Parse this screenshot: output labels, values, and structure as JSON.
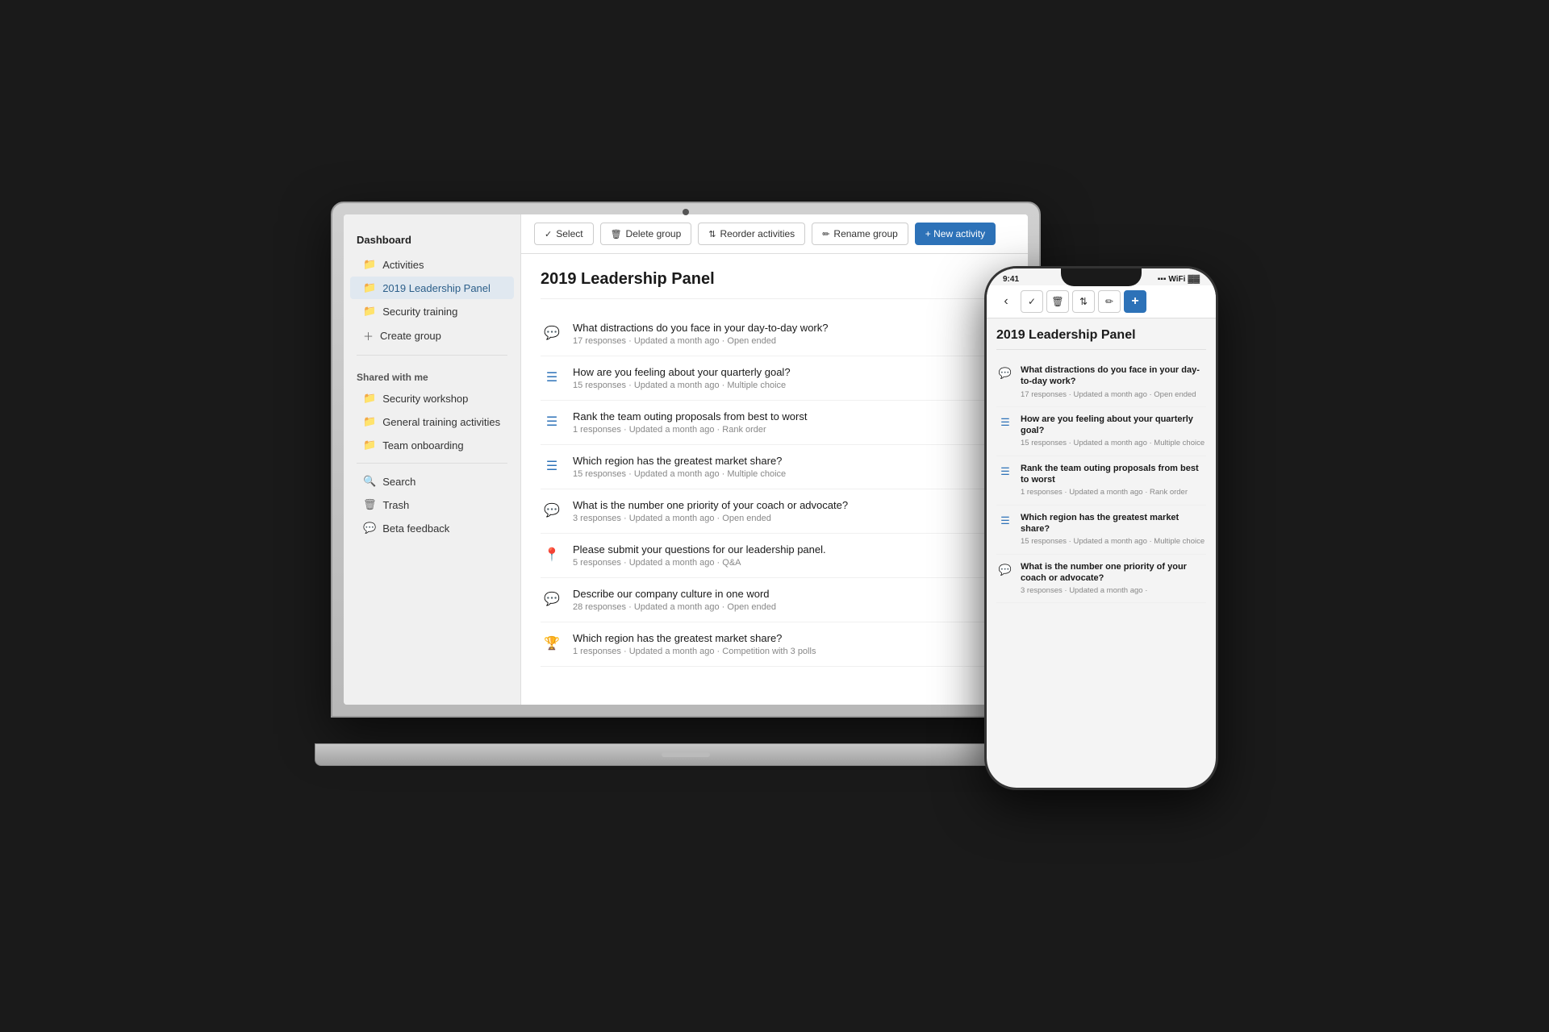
{
  "colors": {
    "accent": "#2d72b8",
    "active_nav_bg": "#e0e8f0",
    "sidebar_bg": "#f0f0f0",
    "border": "#ddd"
  },
  "sidebar": {
    "dashboard_label": "Dashboard",
    "nav_items": [
      {
        "id": "activities",
        "label": "Activities",
        "active": false
      },
      {
        "id": "leadership",
        "label": "2019 Leadership Panel",
        "active": true
      },
      {
        "id": "security-training",
        "label": "Security training",
        "active": false
      },
      {
        "id": "create-group",
        "label": "Create group",
        "active": false,
        "is_create": true
      }
    ],
    "shared_section_label": "Shared with me",
    "shared_items": [
      {
        "id": "security-workshop",
        "label": "Security workshop"
      },
      {
        "id": "general-training",
        "label": "General training activities"
      },
      {
        "id": "team-onboarding",
        "label": "Team onboarding"
      }
    ],
    "bottom_items": [
      {
        "id": "search",
        "label": "Search"
      },
      {
        "id": "trash",
        "label": "Trash"
      },
      {
        "id": "beta-feedback",
        "label": "Beta feedback"
      }
    ]
  },
  "toolbar": {
    "select_label": "Select",
    "delete_label": "Delete group",
    "reorder_label": "Reorder activities",
    "rename_label": "Rename group",
    "new_label": "+ New activity"
  },
  "main": {
    "page_title": "2019 Leadership Panel",
    "activities": [
      {
        "id": 1,
        "type": "open-ended",
        "title": "What distractions do you face in your day-to-day work?",
        "meta": "17 responses · Updated a month ago · Open ended"
      },
      {
        "id": 2,
        "type": "multiple-choice",
        "title": "How are you feeling about your quarterly goal?",
        "meta": "15 responses · Updated a month ago · Multiple choice"
      },
      {
        "id": 3,
        "type": "rank",
        "title": "Rank the team outing proposals from best to worst",
        "meta": "1 responses · Updated a month ago · Rank order"
      },
      {
        "id": 4,
        "type": "multiple-choice",
        "title": "Which region has the greatest market share?",
        "meta": "15 responses · Updated a month ago · Multiple choice"
      },
      {
        "id": 5,
        "type": "open-ended",
        "title": "What is the number one priority of your coach or advocate?",
        "meta": "3 responses · Updated a month ago · Open ended"
      },
      {
        "id": 6,
        "type": "qa",
        "title": "Please submit your questions for our leadership panel.",
        "meta": "5 responses · Updated a month ago · Q&A"
      },
      {
        "id": 7,
        "type": "open-ended",
        "title": "Describe our company culture in one word",
        "meta": "28 responses · Updated a month ago · Open ended"
      },
      {
        "id": 8,
        "type": "competition",
        "title": "Which region has the greatest market share?",
        "meta": "1 responses · Updated a month ago · Competition with 3 polls"
      }
    ]
  },
  "phone": {
    "status_time": "9:41",
    "page_title": "2019 Leadership Panel",
    "activities": [
      {
        "id": 1,
        "type": "open-ended",
        "title": "What distractions do you face in your day-to-day work?",
        "meta": "17 responses · Updated a month ago ·\nOpen ended"
      },
      {
        "id": 2,
        "type": "multiple-choice",
        "title": "How are you feeling about your quarterly goal?",
        "meta": "15 responses · Updated a month ago · Multiple choice"
      },
      {
        "id": 3,
        "type": "rank",
        "title": "Rank the team outing proposals from best to worst",
        "meta": "1 responses · Updated a month ago · Rank order"
      },
      {
        "id": 4,
        "type": "multiple-choice",
        "title": "Which region has the greatest market share?",
        "meta": "15 responses · Updated a month ago · Multiple choice"
      },
      {
        "id": 5,
        "type": "open-ended",
        "title": "What is the number one priority of your coach or advocate?",
        "meta": "3 responses · Updated a month ago ·"
      }
    ]
  }
}
